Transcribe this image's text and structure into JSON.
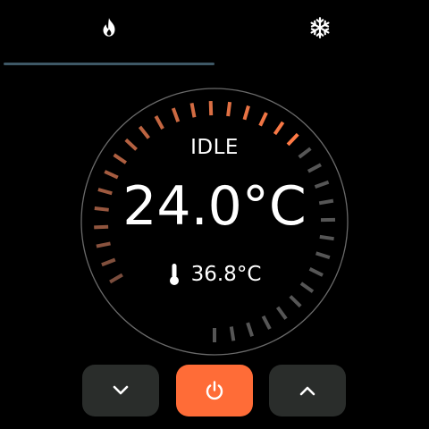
{
  "tabs": [
    {
      "id": "heat",
      "icon": "flame-icon",
      "active": true
    },
    {
      "id": "cool",
      "icon": "snowflake-icon",
      "active": false
    }
  ],
  "thermostat": {
    "state": "IDLE",
    "setpoint": "24.0°C",
    "current_temp": "36.8°C",
    "current_icon": "thermometer-icon",
    "setpoint_fraction": 0.56
  },
  "controls": {
    "down_icon": "chevron-down-icon",
    "power_icon": "power-icon",
    "up_icon": "chevron-up-icon"
  },
  "colors": {
    "background": "#000000",
    "accent": "#ff6c37",
    "tab_indicator": "#3e5866",
    "button_bg": "#2a2d2b",
    "dial_ring": "#6a6a6a",
    "tick_active_start": "#7a4d3d",
    "tick_active_end": "#ff7a45",
    "tick_inactive": "#565656",
    "text": "#ffffff"
  }
}
